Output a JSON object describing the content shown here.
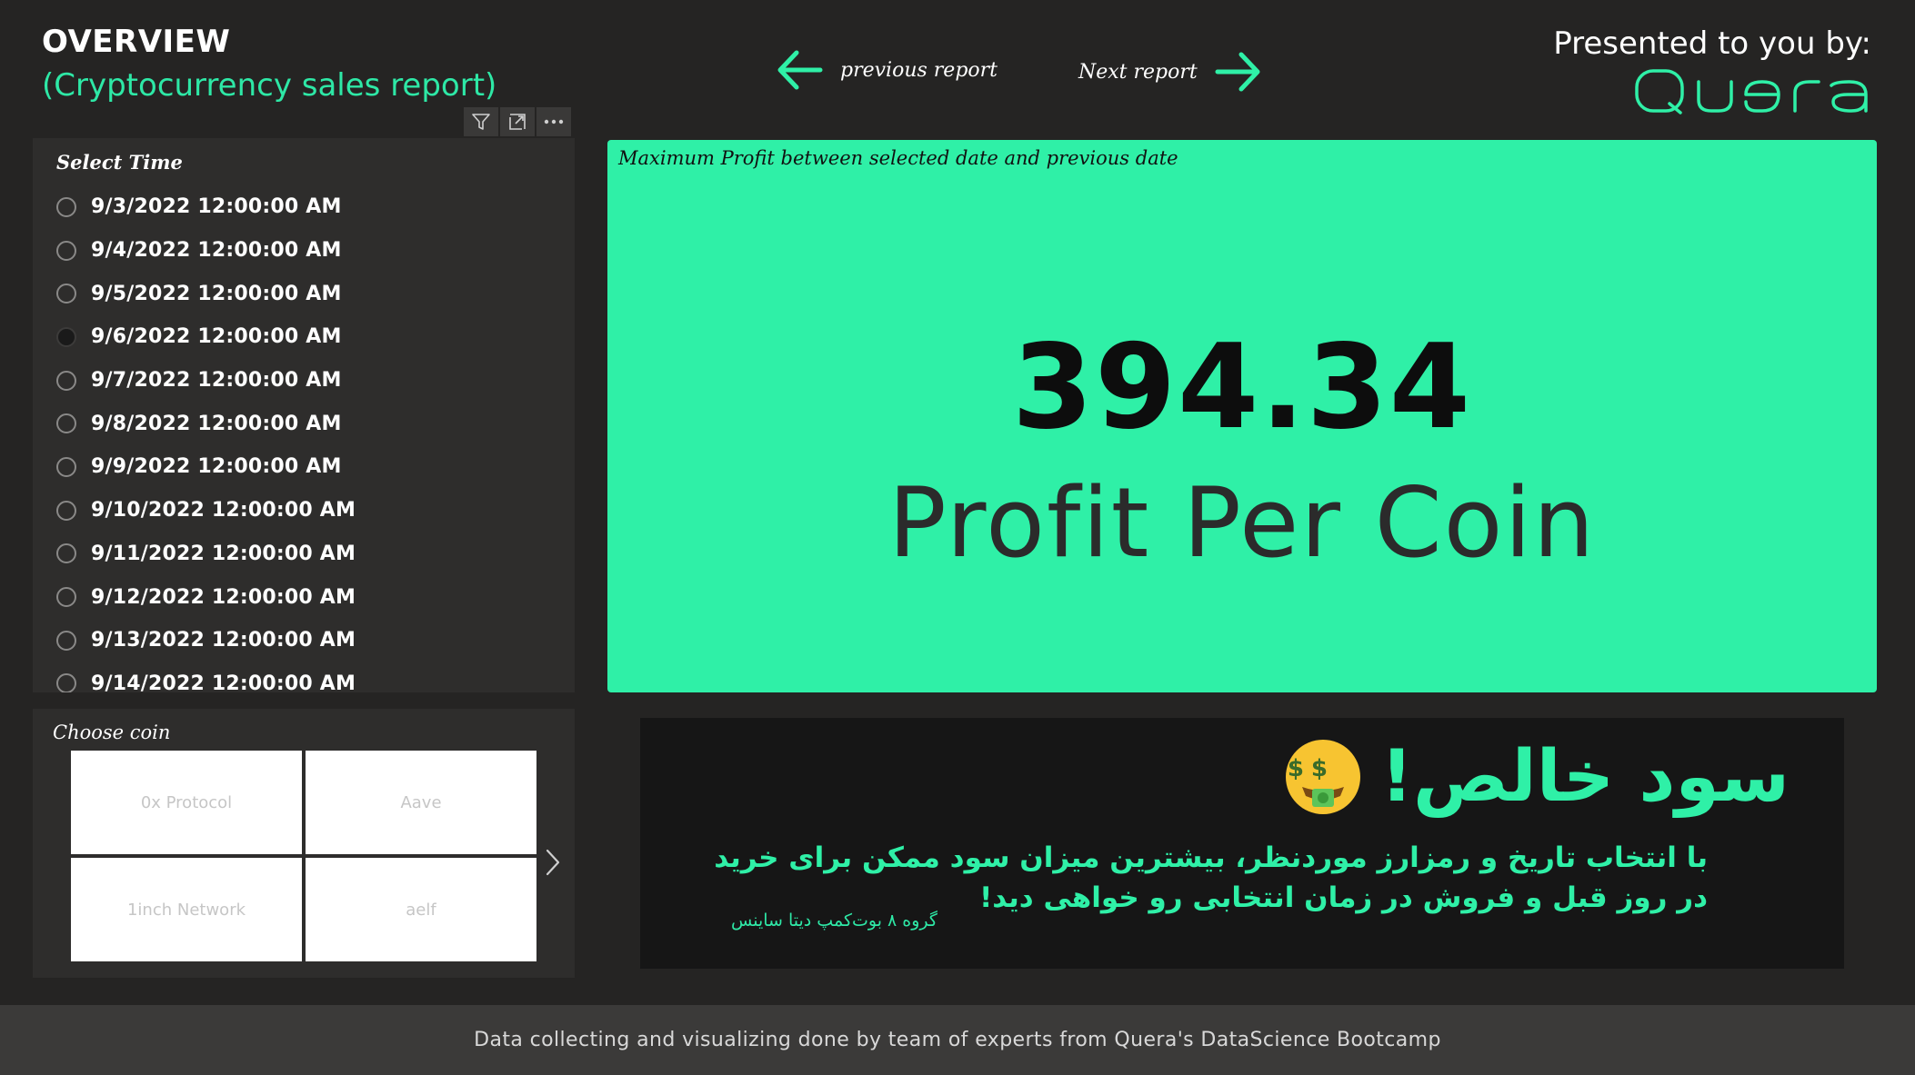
{
  "header": {
    "title": "OVERVIEW",
    "subtitle": "(Cryptocurrency sales report)",
    "prev_label": "previous report",
    "next_label": "Next report",
    "presented_by": "Presented to you by:",
    "logo_text": "Quera"
  },
  "colors": {
    "accent": "#2ff0a7",
    "background": "#252423",
    "panel": "#2e2d2c",
    "info_card": "#161616",
    "footer": "#3b3a39"
  },
  "toolbar": {
    "icons": [
      "filter-icon",
      "focus-mode-icon",
      "more-options-icon"
    ]
  },
  "time_slicer": {
    "title": "Select Time",
    "selected_index": 3,
    "items": [
      "9/3/2022 12:00:00 AM",
      "9/4/2022 12:00:00 AM",
      "9/5/2022 12:00:00 AM",
      "9/6/2022 12:00:00 AM",
      "9/7/2022 12:00:00 AM",
      "9/8/2022 12:00:00 AM",
      "9/9/2022 12:00:00 AM",
      "9/10/2022 12:00:00 AM",
      "9/11/2022 12:00:00 AM",
      "9/12/2022 12:00:00 AM",
      "9/13/2022 12:00:00 AM",
      "9/14/2022 12:00:00 AM"
    ]
  },
  "coin_slicer": {
    "title": "Choose coin",
    "coins": [
      "0x Protocol",
      "Aave",
      "1inch Network",
      "aelf"
    ]
  },
  "kpi": {
    "caption": "Maximum Profit between selected date and previous date",
    "value": "394.34",
    "label": "Profit Per Coin"
  },
  "info": {
    "headline": "سود خالص!",
    "body": "با انتخاب تاریخ و رمزارز موردنظر، بیشترین میزان سود ممکن برای خرید در روز قبل و فروش در زمان انتخابی رو خواهی دید!",
    "group": "گروه ۸ بوت‌کمپ دیتا ساینس"
  },
  "footer": {
    "text": "Data collecting and visualizing done by team of experts from Quera's DataScience Bootcamp"
  }
}
